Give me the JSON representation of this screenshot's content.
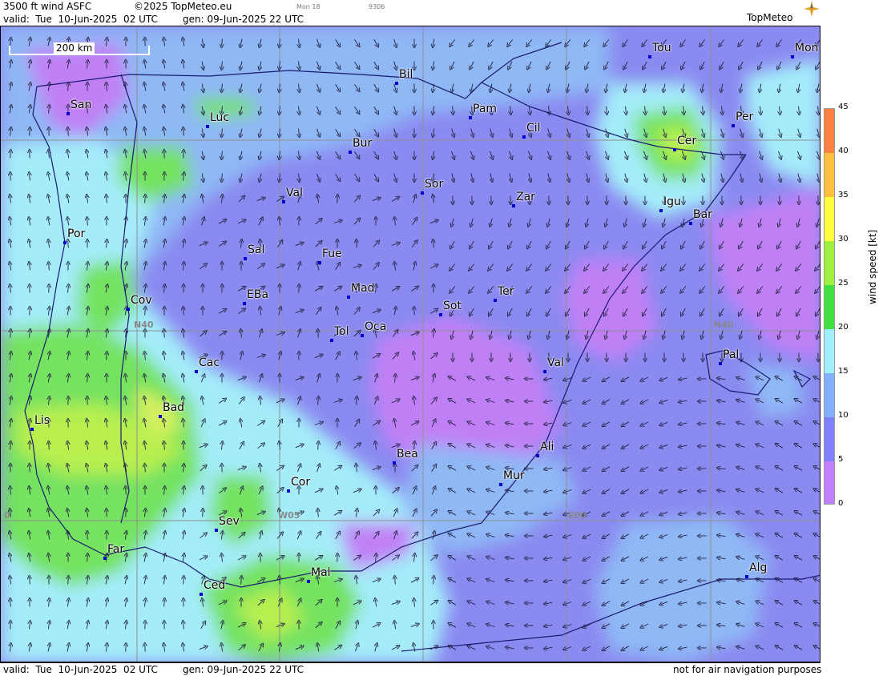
{
  "header": {
    "product": "3500 ft wind ASFC",
    "copyright": "©2025 TopMeteo.eu",
    "small1": "Mon 18",
    "small2": "9306",
    "valid": "valid:  Tue  10-Jun-2025  02 UTC",
    "gen": "gen: 09-Jun-2025 22 UTC",
    "brand": "TopMeteo"
  },
  "footer": {
    "valid": "valid:  Tue  10-Jun-2025  02 UTC",
    "gen": "gen: 09-Jun-2025 22 UTC",
    "note": "not for air navigation purposes"
  },
  "map": {
    "scale_label": "200 km",
    "grid_labels": [
      "N40",
      "N40",
      "W05",
      "E00",
      "0"
    ],
    "cities": [
      {
        "name": "Tou"
      },
      {
        "name": "Mon"
      },
      {
        "name": "Bil"
      },
      {
        "name": "San"
      },
      {
        "name": "Pam"
      },
      {
        "name": "Luc"
      },
      {
        "name": "Per"
      },
      {
        "name": "Cil"
      },
      {
        "name": "Cer"
      },
      {
        "name": "Bur"
      },
      {
        "name": "Sor"
      },
      {
        "name": "Val"
      },
      {
        "name": "Zar"
      },
      {
        "name": "Igu"
      },
      {
        "name": "Bar"
      },
      {
        "name": "Por"
      },
      {
        "name": "Sal"
      },
      {
        "name": "Fue"
      },
      {
        "name": "Mad"
      },
      {
        "name": "Cov"
      },
      {
        "name": "EBa"
      },
      {
        "name": "Ter"
      },
      {
        "name": "Sot"
      },
      {
        "name": "Tol"
      },
      {
        "name": "Oca"
      },
      {
        "name": "Pal"
      },
      {
        "name": "Cac"
      },
      {
        "name": "Val"
      },
      {
        "name": "Bad"
      },
      {
        "name": "Lis"
      },
      {
        "name": "Ali"
      },
      {
        "name": "Bea"
      },
      {
        "name": "Mur"
      },
      {
        "name": "Cor"
      },
      {
        "name": "Sev"
      },
      {
        "name": "Far"
      },
      {
        "name": "Mal"
      },
      {
        "name": "Alg"
      },
      {
        "name": "Ced"
      }
    ]
  },
  "legend": {
    "unit": "wind  speed  [kt]",
    "ticks": [
      "45",
      "40",
      "35",
      "30",
      "25",
      "20",
      "15",
      "10",
      "5",
      "0"
    ],
    "colors": [
      "#c080ff",
      "#8080ff",
      "#80b0ff",
      "#a0f0ff",
      "#40e040",
      "#a0f040",
      "#ffff40",
      "#ffc040",
      "#ff8040",
      "#ff4040"
    ]
  }
}
